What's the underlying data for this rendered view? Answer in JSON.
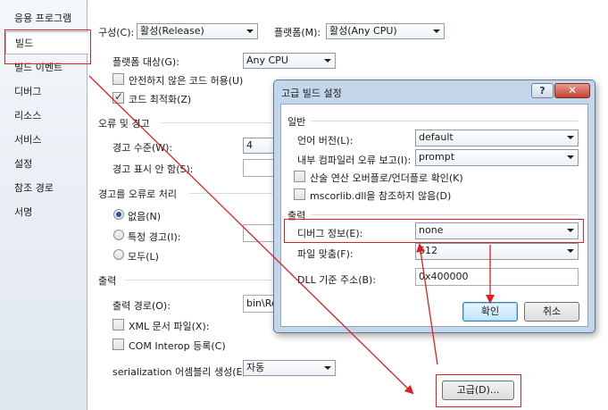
{
  "sidebar": {
    "items": [
      {
        "label": "응용 프로그램"
      },
      {
        "label": "빌드"
      },
      {
        "label": "빌드 이벤트"
      },
      {
        "label": "디버그"
      },
      {
        "label": "리소스"
      },
      {
        "label": "서비스"
      },
      {
        "label": "설정"
      },
      {
        "label": "참조 경로"
      },
      {
        "label": "서명"
      }
    ],
    "active_index": 1
  },
  "toolbar": {
    "config_label": "구성(C):",
    "config_value": "활성(Release)",
    "platform_label": "플랫폼(M):",
    "platform_value": "활성(Any CPU)"
  },
  "general": {
    "platform_target_label": "플랫폼 대상(G):",
    "platform_target_value": "Any CPU",
    "unsafe_code_label": "안전하지 않은 코드 허용(U)",
    "unsafe_code_checked": false,
    "optimize_label": "코드 최적화(Z)",
    "optimize_checked": true
  },
  "errors": {
    "section_title": "오류 및 경고",
    "warning_level_label": "경고 수준(W):",
    "warning_level_value": "4",
    "suppress_label": "경고 표시 안 함(S):"
  },
  "treat_warnings": {
    "section_title": "경고를 오류로 처리",
    "options": [
      {
        "label": "없음(N)",
        "checked": true
      },
      {
        "label": "특정 경고(I):",
        "checked": false
      },
      {
        "label": "모두(L)",
        "checked": false
      }
    ]
  },
  "output": {
    "section_title": "출력",
    "path_label": "출력 경로(O):",
    "path_value": "bin\\Re",
    "xml_doc_label": "XML 문서 파일(X):",
    "xml_doc_checked": false,
    "com_interop_label": "COM Interop 등록(C)",
    "com_interop_checked": false,
    "serialization_label": "serialization 어셈블리 생성(E):",
    "serialization_value": "자동",
    "advanced_button": "고급(D)..."
  },
  "dialog": {
    "title": "고급 빌드 설정",
    "help_glyph": "?",
    "close_glyph": "✕",
    "general_section": "일반",
    "lang_version_label": "언어 버전(L):",
    "lang_version_value": "default",
    "internal_error_label": "내부 컴파일러 오류 보고(I):",
    "internal_error_value": "prompt",
    "overflow_label": "산술 연산 오버플로/언더플로 확인(K)",
    "overflow_checked": false,
    "mscorlib_label": "mscorlib.dll을 참조하지 않음(D)",
    "mscorlib_checked": false,
    "output_section": "출력",
    "debug_info_label": "디버그 정보(E):",
    "debug_info_value": "none",
    "file_align_label": "파일 맞춤(F):",
    "file_align_value": "512",
    "dll_base_label": "DLL 기준 주소(B):",
    "dll_base_value": "0x400000",
    "ok_button": "확인",
    "cancel_button": "취소"
  },
  "colors": {
    "annotation": "#e02020",
    "dialog_frame": "#c4d6ea",
    "sidebar_bg": "#dfe6ee"
  }
}
